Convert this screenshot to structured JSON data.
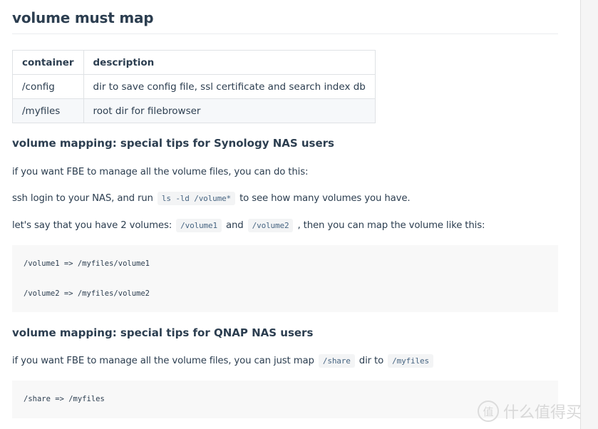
{
  "heading": "volume must map",
  "table": {
    "headers": [
      "container",
      "description"
    ],
    "rows": [
      [
        "/config",
        "dir to save config file, ssl certificate and search index db"
      ],
      [
        "/myfiles",
        "root dir for filebrowser"
      ]
    ]
  },
  "synology": {
    "heading": "volume mapping: special tips for Synology NAS users",
    "p1": "if you want FBE to manage all the volume files, you can do this:",
    "p2": {
      "before": "ssh login to your NAS, and run",
      "code": "ls -ld /volume*",
      "after": "to see how many volumes you have."
    },
    "p3": {
      "before": "let's say that you have 2 volumes:",
      "code1": "/volume1",
      "mid": "and",
      "code2": "/volume2",
      "after": ", then you can map the volume like this:"
    },
    "code_lines": [
      "/volume1 => /myfiles/volume1",
      "/volume2 => /myfiles/volume2"
    ]
  },
  "qnap": {
    "heading": "volume mapping: special tips for QNAP NAS users",
    "p1": {
      "before": "if you want FBE to manage all the volume files, you can just map",
      "code1": "/share",
      "mid": "dir to",
      "code2": "/myfiles"
    },
    "code_lines": [
      "/share => /myfiles"
    ]
  },
  "watermark": {
    "badge": "值",
    "text": "什么值得买"
  }
}
